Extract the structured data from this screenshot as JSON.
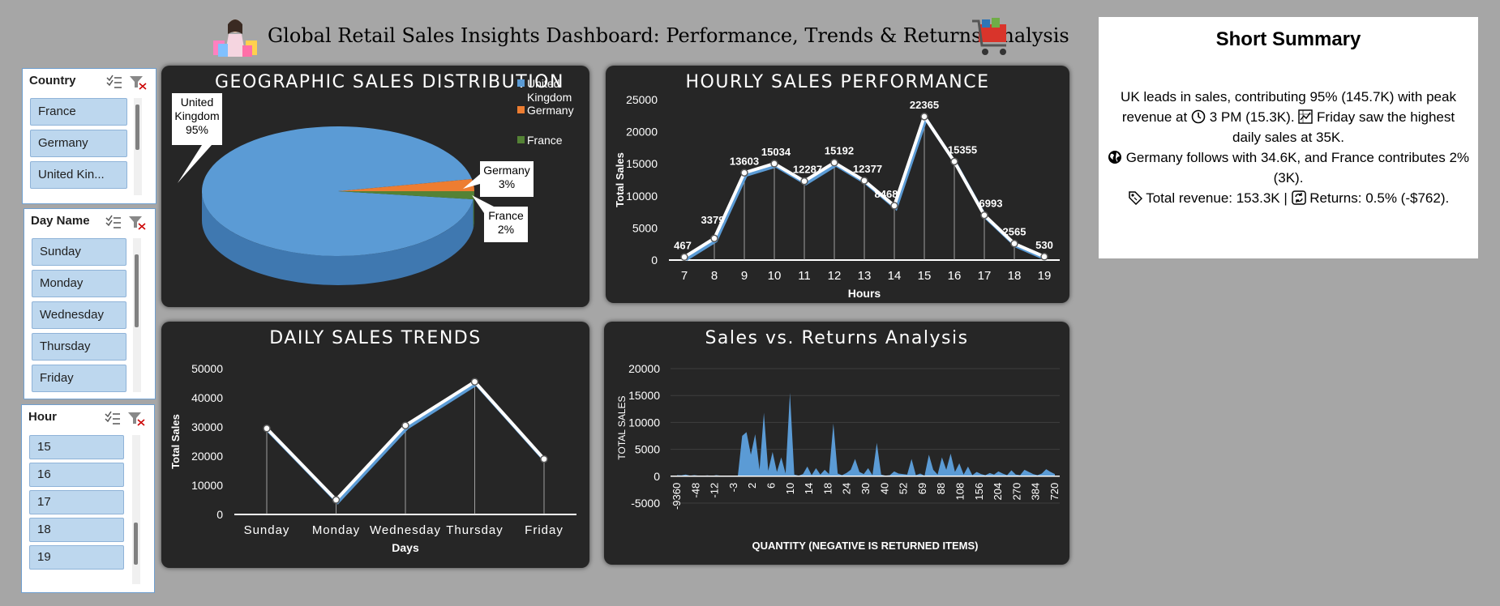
{
  "header": {
    "title": "Global Retail Sales Insights Dashboard: Performance, Trends & Returns Analysis"
  },
  "slicers": {
    "country": {
      "title": "Country",
      "items": [
        "France",
        "Germany",
        "United Kin..."
      ]
    },
    "day": {
      "title": "Day Name",
      "items": [
        "Sunday",
        "Monday",
        "Wednesday",
        "Thursday",
        "Friday"
      ]
    },
    "hour": {
      "title": "Hour",
      "items": [
        "15",
        "16",
        "17",
        "18",
        "19"
      ]
    }
  },
  "summary": {
    "title": "Short Summary",
    "line1a": "UK leads in sales, contributing 95% (145.7K) with peak revenue at",
    "line1b": "3 PM (15.3K).",
    "line1c": "Friday saw the highest daily sales at 35K.",
    "line2": "Germany follows with 34.6K, and France contributes 2% (3K).",
    "line3a": "Total revenue: 153.3K |",
    "line3b": "Returns: 0.5% (-$762)."
  },
  "colors": {
    "blue": "#5b9bd5",
    "orange": "#ed7d31",
    "green": "#548235",
    "panel": "#262626"
  },
  "chart_data": [
    {
      "type": "pie",
      "title": "GEOGRAPHIC SALES DISTRIBUTION",
      "categories": [
        "United Kingdom",
        "Germany",
        "France"
      ],
      "values": [
        95,
        3,
        2
      ],
      "data_labels": [
        {
          "name": "United Kingdom",
          "pct": "95%"
        },
        {
          "name": "Germany",
          "pct": "3%"
        },
        {
          "name": "France",
          "pct": "2%"
        }
      ],
      "legend": [
        "United Kingdom",
        "Germany",
        "France"
      ],
      "legend_position": "right"
    },
    {
      "type": "line",
      "title": "HOURLY SALES PERFORMANCE",
      "x": [
        7,
        8,
        9,
        10,
        11,
        12,
        13,
        14,
        15,
        16,
        17,
        18,
        19
      ],
      "values": [
        467,
        3379,
        13603,
        15034,
        12287,
        15192,
        12377,
        8468,
        22365,
        15355,
        6993,
        2565,
        530
      ],
      "xlabel": "Hours",
      "ylabel": "Total Sales",
      "ylim": [
        0,
        25000
      ],
      "yticks": [
        0,
        5000,
        10000,
        15000,
        20000,
        25000
      ]
    },
    {
      "type": "line",
      "title": "DAILY SALES TRENDS",
      "categories": [
        "Sunday",
        "Monday",
        "Wednesday",
        "Thursday",
        "Friday"
      ],
      "values": [
        29500,
        5000,
        30500,
        45500,
        19000
      ],
      "xlabel": "Days",
      "ylabel": "Total Sales",
      "ylim": [
        0,
        50000
      ],
      "yticks": [
        0,
        10000,
        20000,
        30000,
        40000,
        50000
      ]
    },
    {
      "type": "area",
      "title": "Sales vs. Returns Analysis",
      "xticklabels": [
        "-9360",
        "-48",
        "-12",
        "-3",
        "2",
        "6",
        "10",
        "14",
        "18",
        "24",
        "30",
        "40",
        "52",
        "69",
        "88",
        "108",
        "156",
        "204",
        "270",
        "384",
        "720"
      ],
      "values": [
        200,
        150,
        300,
        100,
        200,
        100,
        80,
        150,
        50,
        200,
        100,
        50,
        30,
        100,
        50,
        7500,
        8200,
        4000,
        7800,
        1200,
        11800,
        1000,
        4500,
        800,
        3500,
        500,
        15500,
        300,
        100,
        400,
        1800,
        200,
        1500,
        300,
        1200,
        400,
        9800,
        500,
        200,
        600,
        1200,
        3200,
        800,
        400,
        1500,
        200,
        6200,
        300,
        100,
        200,
        900,
        500,
        400,
        300,
        3200,
        200,
        500,
        100,
        4000,
        1200,
        300,
        3500,
        1200,
        4200,
        800,
        2400,
        300,
        1800,
        200,
        800,
        400,
        200,
        600,
        300,
        900,
        500,
        200,
        1100,
        300,
        200,
        1200,
        800,
        400,
        200,
        500,
        1300,
        800,
        400
      ],
      "xlabel": "QUANTITY (NEGATIVE IS RETURNED ITEMS)",
      "ylabel": "TOTAL SALES",
      "ylim": [
        -5000,
        20000
      ],
      "yticks": [
        -5000,
        0,
        5000,
        10000,
        15000,
        20000
      ]
    }
  ]
}
